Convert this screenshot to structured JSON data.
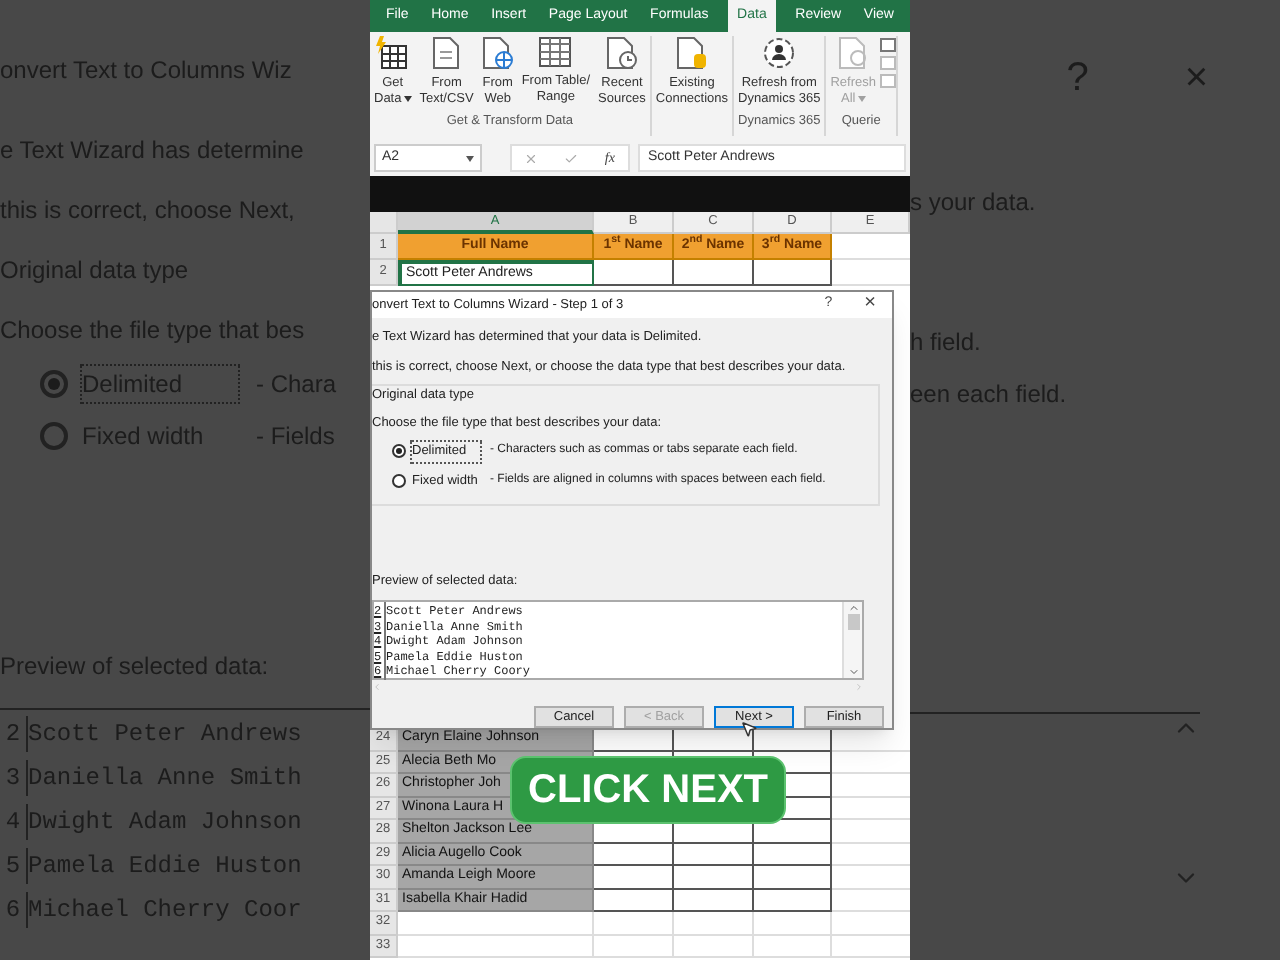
{
  "backdrop": {
    "left": {
      "title": "onvert Text to Columns Wiz",
      "lines": [
        "e Text Wizard has determine",
        "this is correct, choose Next,"
      ],
      "group": "Original data type",
      "prompt": "Choose the file type that bes",
      "options": [
        {
          "label": "Delimited",
          "desc": "- Chara",
          "selected": true
        },
        {
          "label": "Fixed width",
          "desc": "- Fields",
          "selected": false
        }
      ],
      "preview_label": "Preview of selected data:",
      "preview": [
        {
          "n": "2",
          "text": "Scott Peter Andrews"
        },
        {
          "n": "3",
          "text": "Daniella Anne Smith"
        },
        {
          "n": "4",
          "text": "Dwight Adam Johnson"
        },
        {
          "n": "5",
          "text": "Pamela Eddie Huston"
        },
        {
          "n": "6",
          "text": "Michael Cherry Coor"
        }
      ]
    },
    "right": {
      "help": "?",
      "close": "×",
      "lines": [
        "s your data.",
        "h field.",
        "een each field."
      ]
    }
  },
  "ribbon": {
    "tabs": [
      {
        "label": "File",
        "selected": false
      },
      {
        "label": "Home",
        "selected": false
      },
      {
        "label": "Insert",
        "selected": false
      },
      {
        "label": "Page Layout",
        "selected": false
      },
      {
        "label": "Formulas",
        "selected": false
      },
      {
        "label": "Data",
        "selected": true
      },
      {
        "label": "Review",
        "selected": false
      },
      {
        "label": "View",
        "selected": false
      }
    ],
    "groups": [
      {
        "label": "Get & Transform Data",
        "buttons": [
          {
            "kind": "database",
            "lines": [
              "Get",
              "Data"
            ],
            "dropdown": true,
            "disabled": false
          },
          {
            "kind": "document",
            "lines": [
              "From",
              "Text/CSV"
            ],
            "dropdown": false,
            "disabled": false
          },
          {
            "kind": "web",
            "lines": [
              "From",
              "Web"
            ],
            "dropdown": false,
            "disabled": false
          },
          {
            "kind": "table",
            "lines": [
              "From Table/",
              "Range"
            ],
            "dropdown": false,
            "disabled": false
          },
          {
            "kind": "clock",
            "lines": [
              "Recent",
              "Sources"
            ],
            "dropdown": false,
            "disabled": false
          }
        ]
      },
      {
        "buttons": [
          {
            "kind": "connections",
            "lines": [
              "Existing",
              "Connections"
            ],
            "dropdown": false,
            "disabled": false
          }
        ]
      },
      {
        "label": "Dynamics 365",
        "buttons": [
          {
            "kind": "dynamics",
            "lines": [
              "Refresh from",
              "Dynamics 365"
            ],
            "dropdown": false,
            "disabled": false
          }
        ]
      },
      {
        "label": "Querie",
        "buttons": [
          {
            "kind": "refresh",
            "lines": [
              "Refresh",
              "All"
            ],
            "dropdown": true,
            "disabled": true
          }
        ]
      }
    ]
  },
  "formula_bar": {
    "name_box": "A2",
    "function_label": "fx",
    "value": "Scott Peter Andrews"
  },
  "sheet": {
    "columns": [
      {
        "label": "A",
        "selected": true
      },
      {
        "label": "B",
        "selected": false
      },
      {
        "label": "C",
        "selected": false
      },
      {
        "label": "D",
        "selected": false
      },
      {
        "label": "E",
        "selected": false
      }
    ],
    "header_row": {
      "num": "1",
      "cells": [
        "Full Name",
        "1$^{st}$ Name",
        "2$^{nd}$ Name",
        "3$^{rd}$ Name"
      ]
    },
    "top_rows": [
      {
        "num": "2",
        "cells": [
          "Scott Peter Andrews"
        ],
        "selected": false
      }
    ],
    "bottom_rows": [
      {
        "num": "24",
        "cells": [
          "Caryn Elaine Johnson"
        ],
        "selected": true
      },
      {
        "num": "25",
        "cells": [
          "Alecia Beth Mo"
        ],
        "selected": true
      },
      {
        "num": "26",
        "cells": [
          "Christopher Joh"
        ],
        "selected": true
      },
      {
        "num": "27",
        "cells": [
          "Winona Laura H"
        ],
        "selected": true
      },
      {
        "num": "28",
        "cells": [
          "Shelton Jackson Lee"
        ],
        "selected": true
      },
      {
        "num": "29",
        "cells": [
          "Alicia Augello Cook"
        ],
        "selected": true
      },
      {
        "num": "30",
        "cells": [
          "Amanda Leigh Moore"
        ],
        "selected": true
      },
      {
        "num": "31",
        "cells": [
          "Isabella Khair Hadid"
        ],
        "selected": true
      },
      {
        "num": "32",
        "cells": [],
        "selected": false
      },
      {
        "num": "33",
        "cells": [],
        "selected": false
      }
    ]
  },
  "dialog": {
    "title": "onvert Text to Columns Wizard - Step 1 of 3",
    "help": "?",
    "close": "×",
    "intro": [
      "e Text Wizard has determined that your data is Delimited.",
      "this is correct, choose Next, or choose the data type that best describes your data."
    ],
    "group": "Original data type",
    "prompt": "Choose the file type that best describes your data:",
    "options": [
      {
        "label": "Delimited",
        "desc": "- Characters such as commas or tabs separate each field.",
        "selected": true
      },
      {
        "label": "Fixed width",
        "desc": "- Fields are aligned in columns with spaces between each field.",
        "selected": false
      }
    ],
    "preview_label": "Preview of selected data:",
    "preview": [
      {
        "n": "2",
        "text": "Scott Peter Andrews"
      },
      {
        "n": "3",
        "text": "Daniella Anne Smith"
      },
      {
        "n": "4",
        "text": "Dwight Adam Johnson"
      },
      {
        "n": "5",
        "text": "Pamela Eddie Huston"
      },
      {
        "n": "6",
        "text": "Michael Cherry Coory"
      }
    ],
    "buttons": [
      {
        "label": "Cancel",
        "disabled": false,
        "focused": false
      },
      {
        "label": "< Back",
        "disabled": true,
        "focused": false
      },
      {
        "label": "Next >",
        "disabled": false,
        "focused": true
      },
      {
        "label": "Finish",
        "disabled": false,
        "focused": false
      }
    ]
  },
  "caption": "CLICK NEXT"
}
